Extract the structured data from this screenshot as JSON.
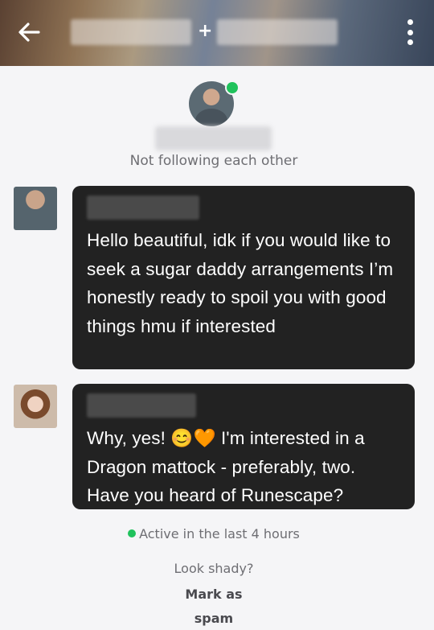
{
  "header": {
    "plus_label": "+",
    "back_icon": "arrow-left-icon",
    "more_icon": "vertical-dots-icon"
  },
  "profile": {
    "follow_status": "Not following each other",
    "online_color": "#20c25c"
  },
  "messages": [
    {
      "text": "Hello beautiful, idk if you would like to seek a sugar daddy arrangements I’m honestly ready to spoil you with good things hmu if interested"
    },
    {
      "text_before_emoji": "Why, yes! ",
      "emoji": "😊🧡",
      "text_after_emoji": " I'm interested in a Dragon mattock - preferably, two. Have you heard of Runescape?"
    }
  ],
  "footer": {
    "active_status": "Active in the last 4 hours",
    "shady_question": "Look shady?",
    "spam_label_line1": "Mark as",
    "spam_label_line2": "spam"
  },
  "colors": {
    "bubble": "#222222",
    "background": "#f5f5f7",
    "secondary_text": "#6e6e73",
    "active": "#20c25c"
  }
}
